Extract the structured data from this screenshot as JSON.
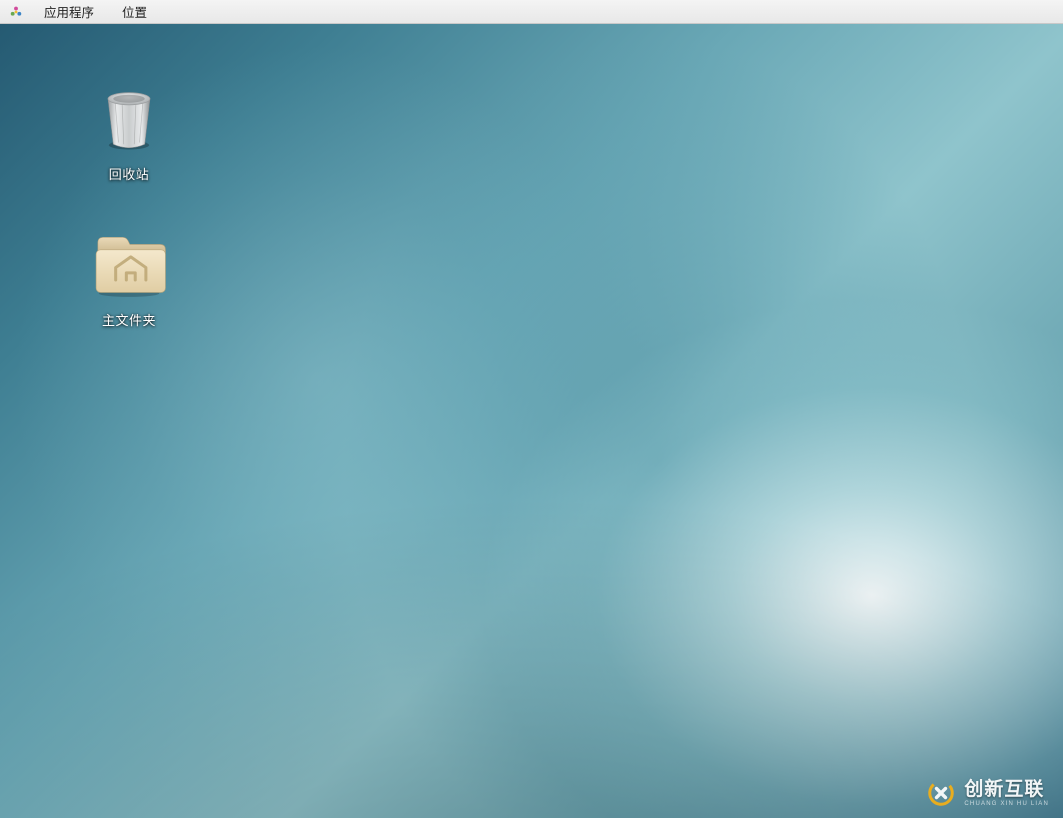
{
  "menubar": {
    "applications_label": "应用程序",
    "places_label": "位置"
  },
  "desktop": {
    "icons": [
      {
        "id": "trash",
        "label": "回收站",
        "icon": "trash-icon"
      },
      {
        "id": "home",
        "label": "主文件夹",
        "icon": "home-folder-icon"
      }
    ]
  },
  "watermark": {
    "brand": "创新互联",
    "sub": "CHUANG XIN HU LIAN"
  }
}
